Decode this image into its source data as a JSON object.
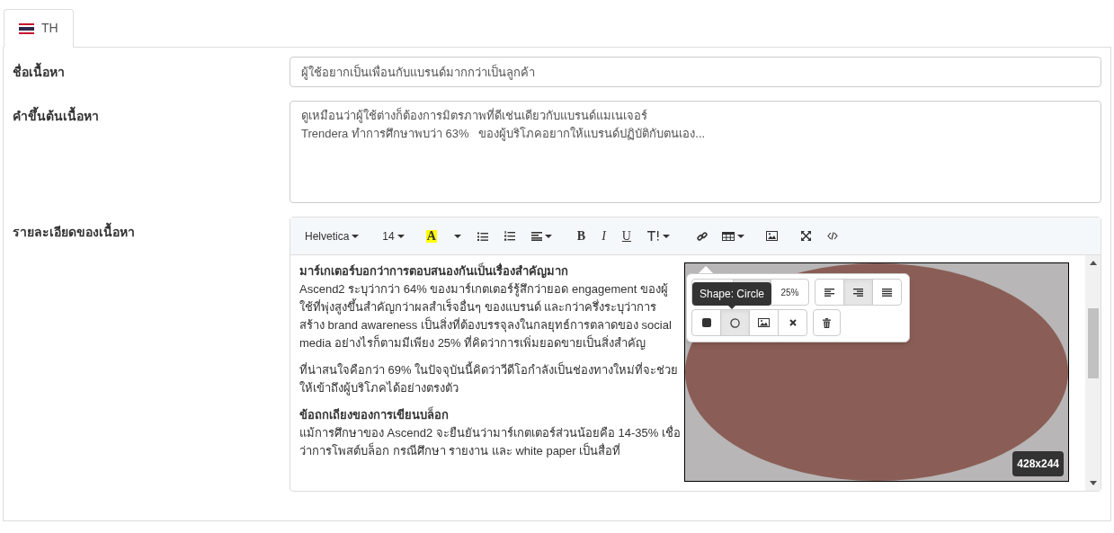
{
  "tabs": [
    {
      "label": "TH",
      "selected": true
    }
  ],
  "fields": [
    {
      "kind": "input",
      "label": "ชื่อเนื้อหา",
      "value": "ผู้ใช้อยากเป็นเพื่อนกับแบรนด์มากกว่าเป็นลูกค้า"
    },
    {
      "kind": "textarea",
      "label": "คำขึ้นต้นเนื้อหา",
      "value": "ดูเหมือนว่าผู้ใช้ต่างก็ต้องการมิตรภาพที่ดีเช่นเดียวกับแบรนด์แมเนเจอร์\nTrendera ทำการศึกษาพบว่า 63%   ของผู้บริโภคอยากให้แบรนด์ปฏิบัติกับตนเอง..."
    },
    {
      "kind": "editor",
      "label": "รายละเอียดของเนื้อหา"
    }
  ],
  "editor": {
    "toolbar": {
      "font": "Helvetica",
      "size": "14",
      "color_letter": "A",
      "format_letters": [
        "B",
        "I",
        "U"
      ]
    },
    "blocks": [
      {
        "kind": "heading",
        "text": "มาร์เกเตอร์บอกว่าการตอบสนองกันเป็นเรื่องสำคัญมาก"
      },
      {
        "kind": "paragraph",
        "text": "Ascend2 ระบุว่ากว่า 64% ของมาร์เกตเตอร์รู้สึกว่ายอด engagement ของผู้ใช้ที่พุ่งสูงขึ้นสำคัญกว่าผลสำเร็จอื่นๆ ของแบรนด์ และกว่าครึ่งระบุว่าการสร้าง brand awareness เป็นสิ่งที่ต้องบรรจุลงในกลยุทธ์การตลาดของ social media อย่างไรก็ตามมีเพียง 25% ที่คิดว่าการเพิ่มยอดขายเป็นสิ่งสำคัญ"
      },
      {
        "kind": "paragraph",
        "text": "ที่น่าสนใจคือกว่า 69% ในปัจจุบันนี้คิดว่าวีดีโอกำลังเป็นช่องทางใหม่ที่จะช่วยให้เข้าถึงผู้บริโภคได้อย่างตรงตัว"
      },
      {
        "kind": "heading",
        "text": "ข้อถกเถียงของการเขียนบล็อก"
      },
      {
        "kind": "paragraph",
        "text": "แม้การศึกษาของ Ascend2 จะยืนยันว่ามาร์เกตเตอร์ส่วนน้อยคือ 14-35% เชื่อว่าการโพสต์บล็อก กรณีศึกษา รายงาน และ white paper เป็นสื่อที่"
      }
    ],
    "image": {
      "size_badge": "428x244"
    },
    "popover": {
      "tooltip": "Shape: Circle",
      "size_buttons": [
        {
          "selected": false
        },
        {
          "selected": true
        },
        {
          "label": "25%",
          "selected": false
        }
      ],
      "align_buttons": [
        {
          "selected": false
        },
        {
          "selected": true
        },
        {
          "selected": false
        }
      ],
      "shape_buttons": [
        {
          "selected": false
        },
        {
          "selected": true
        },
        {
          "selected": false
        }
      ]
    }
  }
}
